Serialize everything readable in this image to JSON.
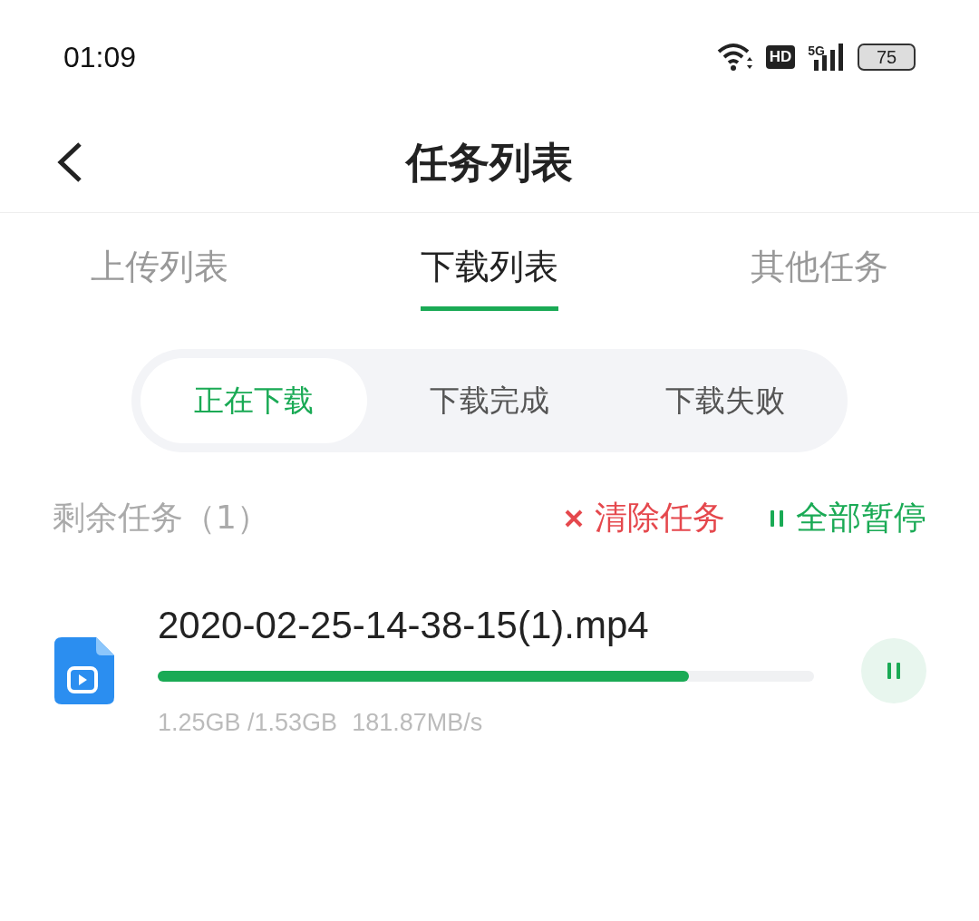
{
  "status_bar": {
    "time": "01:09",
    "hd": "HD",
    "network": "5G",
    "battery": "75"
  },
  "header": {
    "title": "任务列表"
  },
  "tabs": [
    {
      "label": "上传列表",
      "selected": false
    },
    {
      "label": "下载列表",
      "selected": true
    },
    {
      "label": "其他任务",
      "selected": false
    }
  ],
  "segments": [
    {
      "label": "正在下载",
      "selected": true
    },
    {
      "label": "下载完成",
      "selected": false
    },
    {
      "label": "下载失败",
      "selected": false
    }
  ],
  "summary": {
    "remaining": "剩余任务（1）",
    "clear": "清除任务",
    "pause_all": "全部暂停"
  },
  "downloads": [
    {
      "name": "2020-02-25-14-38-15(1).mp4",
      "level": 0.81,
      "size": "1.25GB /1.53GB",
      "speed": "181.87MB/s",
      "paused": false
    }
  ]
}
